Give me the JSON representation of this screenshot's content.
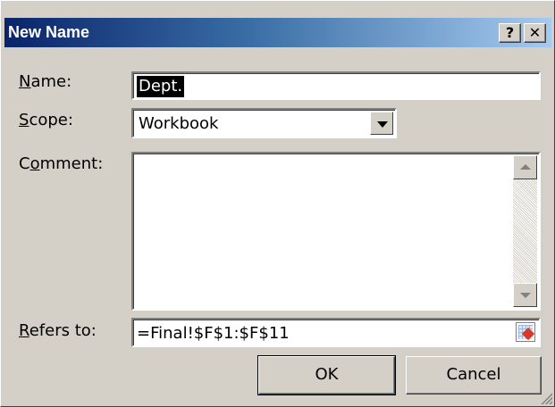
{
  "window": {
    "title": "New Name",
    "help_label": "?",
    "close_label": "✕"
  },
  "fields": {
    "name": {
      "label_prefix": "",
      "label_mnemonic": "N",
      "label_rest": "ame:",
      "value": "Dept."
    },
    "scope": {
      "label_mnemonic": "S",
      "label_rest": "cope:",
      "value": "Workbook"
    },
    "comment": {
      "label_prefix": "C",
      "label_mnemonic": "o",
      "label_rest": "mment:",
      "value": ""
    },
    "refers_to": {
      "label_mnemonic": "R",
      "label_rest": "efers to:",
      "value": "=Final!$F$1:$F$11"
    }
  },
  "buttons": {
    "ok": "OK",
    "cancel": "Cancel"
  },
  "icons": {
    "dropdown": "chevron-down-icon",
    "scroll_up": "scroll-up-icon",
    "scroll_down": "scroll-down-icon",
    "collapse": "collapse-dialog-icon",
    "grip": "resize-grip-icon"
  }
}
